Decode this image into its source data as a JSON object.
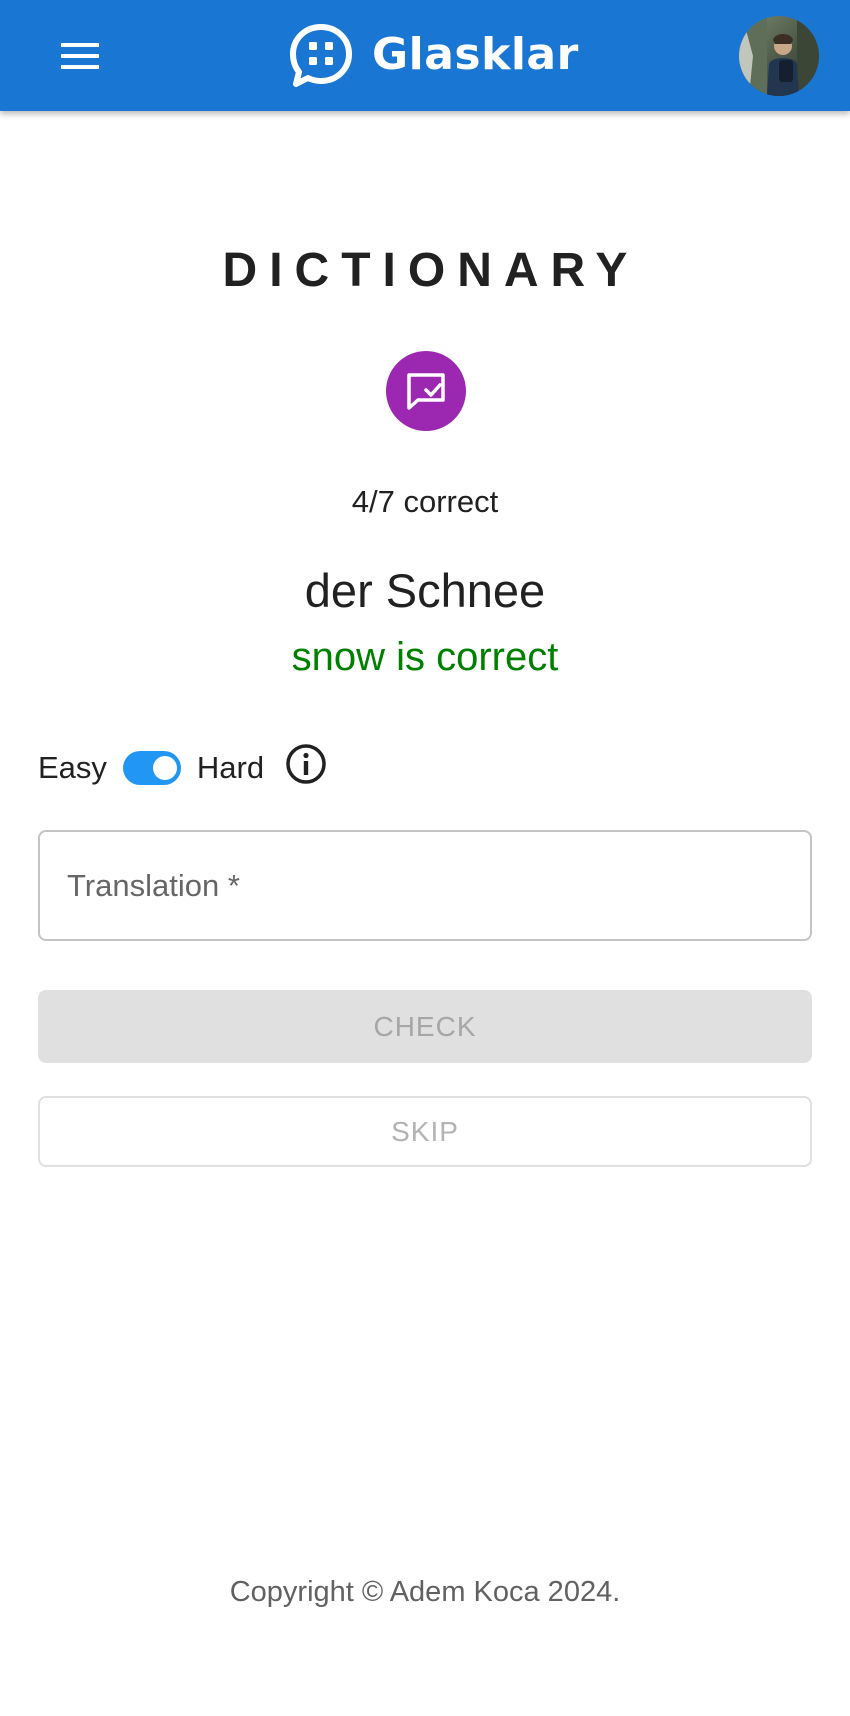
{
  "header": {
    "brand_name": "Glasklar",
    "menu_icon": "hamburger-menu-icon",
    "logo_icon": "chat-bubble-logo-icon",
    "avatar": "user-avatar-photo",
    "background_color": "#1976d2"
  },
  "main": {
    "title": "DICTIONARY",
    "quiz_icon": "quiz-check-icon",
    "quiz_icon_color": "#9c27b0",
    "score_text": "4/7 correct",
    "word": "der Schnee",
    "result_text": "snow is correct",
    "result_color": "#008000"
  },
  "mode": {
    "easy_label": "Easy",
    "hard_label": "Hard",
    "hard_enabled": true,
    "switch_color": "#2196f3",
    "info_icon": "info-icon"
  },
  "form": {
    "translation_placeholder": "Translation *",
    "translation_value": "",
    "check_label": "CHECK",
    "skip_label": "SKIP"
  },
  "footer": {
    "copyright": "Copyright © Adem Koca 2024."
  }
}
